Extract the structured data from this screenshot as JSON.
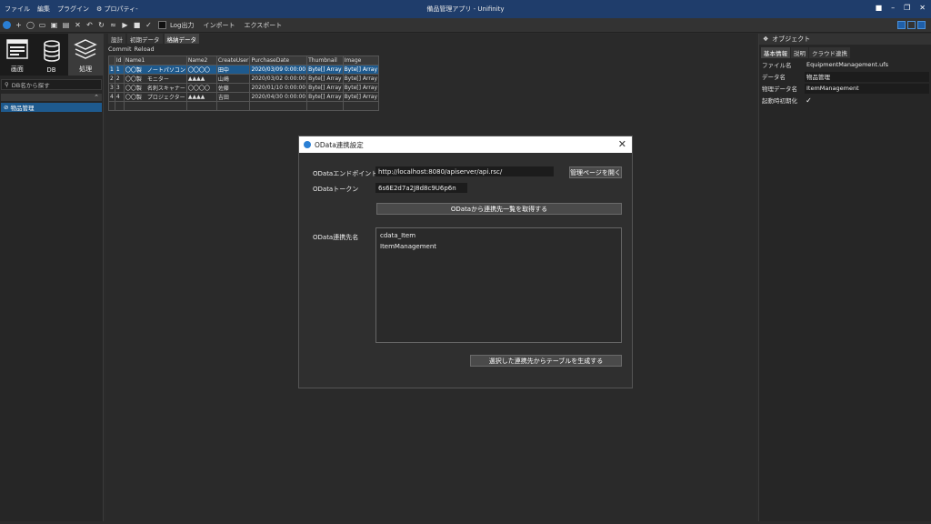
{
  "titlebar": {
    "menu": [
      "ファイル",
      "編集",
      "プラグイン",
      "⚙ プロパティ-"
    ],
    "title": "備品管理アプリ - Unifinity"
  },
  "toolbar": {
    "log_label": "Log出力",
    "import_label": "インポート",
    "export_label": "エクスポート"
  },
  "left": {
    "categories": [
      {
        "label": "画面",
        "icon": "screen-icon"
      },
      {
        "label": "DB",
        "icon": "database-icon"
      },
      {
        "label": "処理",
        "icon": "process-icon"
      }
    ],
    "search_placeholder": "DB名から探す",
    "tree_item": "物品管理"
  },
  "center": {
    "tabs": [
      "設計",
      "初期データ",
      "格納データ"
    ],
    "actions": [
      "Commit",
      "Reload"
    ],
    "columns": [
      "Id",
      "Name1",
      "Name2",
      "CreateUser",
      "PurchaseDate",
      "Thumbnail",
      "Image"
    ],
    "rows": [
      [
        "1",
        "1",
        "〇〇製　ノートパソコン",
        "〇〇〇〇",
        "田中",
        "2020/03/09 0:00:00",
        "Byte[] Array",
        "Byte[] Array"
      ],
      [
        "2",
        "2",
        "〇〇製　モニター",
        "▲▲▲▲",
        "山崎",
        "2020/03/02 0:00:00",
        "Byte[] Array",
        "Byte[] Array"
      ],
      [
        "3",
        "3",
        "〇〇製　名刺スキャナー",
        "〇〇〇〇",
        "佐藤",
        "2020/01/10 0:00:00",
        "Byte[] Array",
        "Byte[] Array"
      ],
      [
        "4",
        "4",
        "〇〇製　プロジェクター",
        "▲▲▲▲",
        "吉田",
        "2020/04/30 0:00:00",
        "Byte[] Array",
        "Byte[] Array"
      ]
    ]
  },
  "right": {
    "header": "オブジェクト",
    "tabs": [
      "基本情報",
      "説明",
      "クラウド連携"
    ],
    "props": [
      {
        "key": "ファイル名",
        "value": "EquipmentManagement.ufs"
      },
      {
        "key": "データ名",
        "value": "物品管理"
      },
      {
        "key": "物理データ名",
        "value": "ItemManagement"
      },
      {
        "key": "起動時初期化",
        "value": ""
      }
    ]
  },
  "dialog": {
    "title": "OData連携設定",
    "endpoint_label": "ODataエンドポイント",
    "endpoint_value": "http://localhost:8080/apiserver/api.rsc/",
    "open_admin_button": "管理ページを開く",
    "token_label": "ODataトークン",
    "token_value": "6s6E2d7a2J8d8c9U6p6n",
    "fetch_button": "ODataから連携先一覧を取得する",
    "targets_label": "OData連携先名",
    "targets": [
      "cdata_Item",
      "ItemManagement"
    ],
    "generate_button": "選択した連携先からテーブルを生成する"
  }
}
